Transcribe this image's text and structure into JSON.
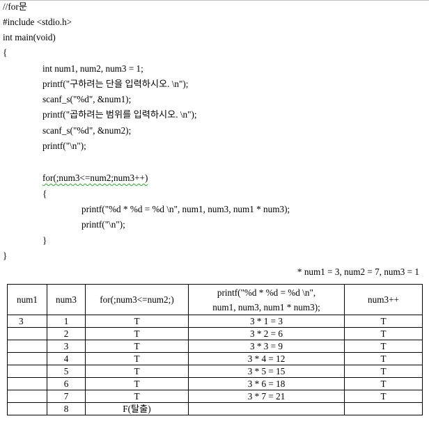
{
  "code_lines": [
    "//for문",
    "#include <stdio.h>",
    "int main(void)",
    "{",
    "int num1, num2, num3 = 1;",
    "printf(\"구하려는 단을 입력하시오. \\n\");",
    "scanf_s(\"%d\", &num1);",
    "printf(\"곱하려는 범위를 입력하시오. \\n\");",
    "scanf_s(\"%d\", &num2);",
    "printf(\"\\n\");",
    "for(;num3<=num2;num3++)",
    "{",
    "printf(\"%d * %d = %d \\n\", num1, num3, num1 * num3);",
    "printf(\"\\n\");",
    "}",
    "}"
  ],
  "note": "* num1 = 3, num2 = 7, num3 = 1",
  "table": {
    "headers": [
      "num1",
      "num3",
      "for(;num3<=num2;)",
      "printf(\"%d * %d = %d \\n\",",
      "num1, num3, num1 * num3);",
      "num3++"
    ],
    "rows": [
      [
        "3",
        "1",
        "T",
        "3 * 1 = 3",
        "T"
      ],
      [
        "",
        "2",
        "T",
        "3 * 2 = 6",
        "T"
      ],
      [
        "",
        "3",
        "T",
        "3 * 3 = 9",
        "T"
      ],
      [
        "",
        "4",
        "T",
        "3 * 4 = 12",
        "T"
      ],
      [
        "",
        "5",
        "T",
        "3 * 5 = 15",
        "T"
      ],
      [
        "",
        "6",
        "T",
        "3 * 6 = 18",
        "T"
      ],
      [
        "",
        "7",
        "T",
        "3 * 7 = 21",
        "T"
      ],
      [
        "",
        "8",
        "F(탈출)",
        "",
        ""
      ]
    ]
  }
}
